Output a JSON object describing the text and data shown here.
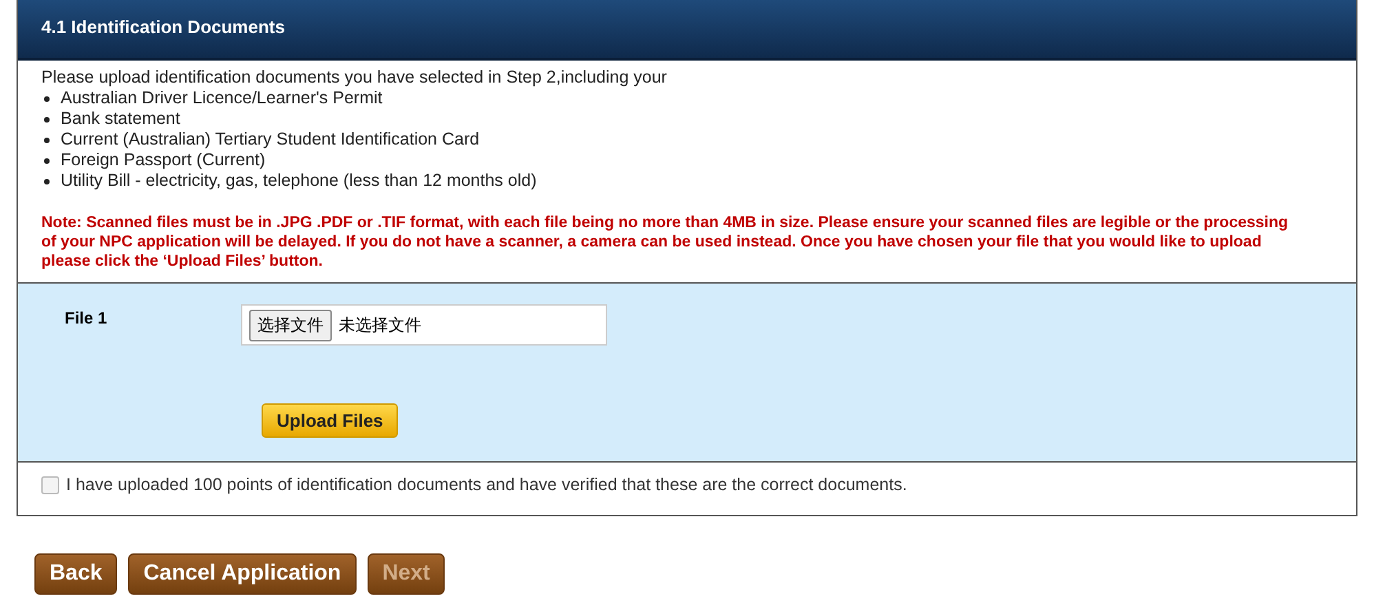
{
  "section": {
    "title": "4.1 Identification Documents"
  },
  "intro": "Please upload identification documents you have selected in Step 2,including your",
  "documents": [
    "Australian Driver Licence/Learner's Permit",
    "Bank statement",
    "Current (Australian) Tertiary Student Identification Card",
    "Foreign Passport (Current)",
    "Utility Bill - electricity, gas, telephone (less than 12 months old)"
  ],
  "note": "Note: Scanned files must be in .JPG .PDF or .TIF format, with each file being no more than 4MB in size. Please ensure your scanned files are legible or the processing of your NPC application will be delayed. If you do not have a scanner, a camera can be used instead. Once you have chosen your file that you would like to upload please click the ‘Upload Files’ button.",
  "upload": {
    "label": "File 1",
    "choose_button": "选择文件",
    "file_status": "未选择文件",
    "upload_button": "Upload Files"
  },
  "confirmation": {
    "label": "I have uploaded 100 points of identification documents and have verified that these are the correct documents.",
    "checked": false
  },
  "buttons": [
    {
      "label": "Back",
      "disabled": false
    },
    {
      "label": "Cancel Application",
      "disabled": false
    },
    {
      "label": "Next",
      "disabled": true
    }
  ]
}
